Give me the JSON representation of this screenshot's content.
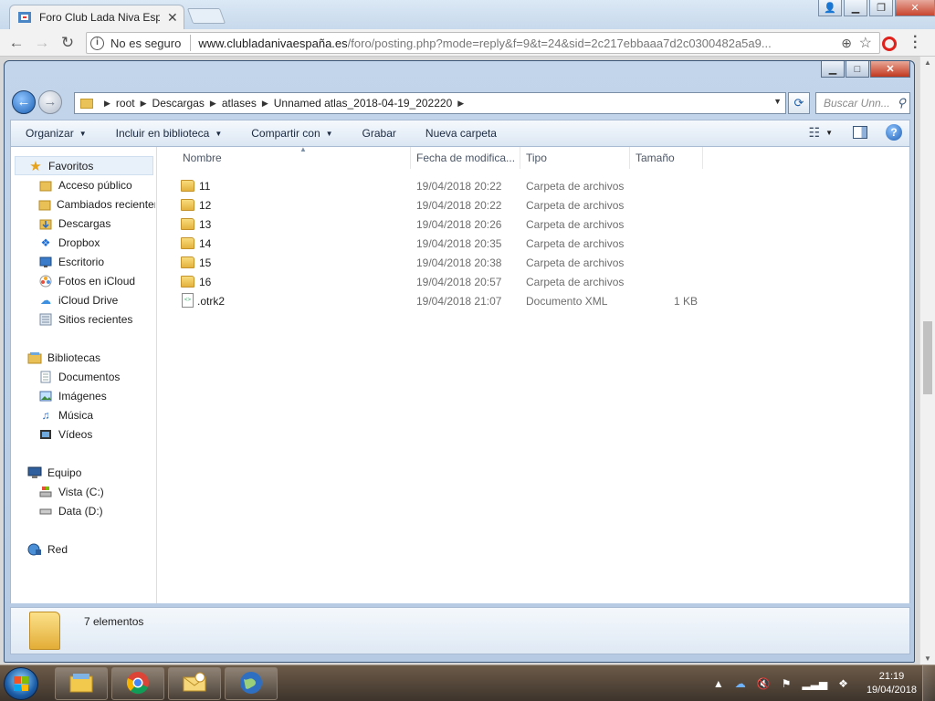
{
  "browser": {
    "tab_title": "Foro Club Lada Niva Espa",
    "insecure_label": "No es seguro",
    "url_host": "www.clubladanivaespaña.es",
    "url_rest": "/foro/posting.php?mode=reply&f=9&t=24&sid=2c217ebbaaa7d2c0300482a5a9..."
  },
  "explorer": {
    "breadcrumb": [
      "root",
      "Descargas",
      "atlases",
      "Unnamed atlas_2018-04-19_202220"
    ],
    "search_placeholder": "Buscar Unn...",
    "toolbar": {
      "organize": "Organizar",
      "include_library": "Incluir en biblioteca",
      "share": "Compartir con",
      "burn": "Grabar",
      "new_folder": "Nueva carpeta"
    },
    "nav": {
      "favorites": {
        "label": "Favoritos",
        "items": [
          "Acceso público",
          "Cambiados recientemente",
          "Descargas",
          "Dropbox",
          "Escritorio",
          "Fotos en iCloud",
          "iCloud Drive",
          "Sitios recientes"
        ]
      },
      "libraries": {
        "label": "Bibliotecas",
        "items": [
          "Documentos",
          "Imágenes",
          "Música",
          "Vídeos"
        ]
      },
      "computer": {
        "label": "Equipo",
        "items": [
          "Vista (C:)",
          "Data (D:)"
        ]
      },
      "network": {
        "label": "Red"
      }
    },
    "columns": [
      "Nombre",
      "Fecha de modifica...",
      "Tipo",
      "Tamaño"
    ],
    "files": [
      {
        "name": "11",
        "date": "19/04/2018 20:22",
        "type": "Carpeta de archivos",
        "size": "",
        "icon": "folder-icon"
      },
      {
        "name": "12",
        "date": "19/04/2018 20:22",
        "type": "Carpeta de archivos",
        "size": "",
        "icon": "folder-icon"
      },
      {
        "name": "13",
        "date": "19/04/2018 20:26",
        "type": "Carpeta de archivos",
        "size": "",
        "icon": "folder-icon"
      },
      {
        "name": "14",
        "date": "19/04/2018 20:35",
        "type": "Carpeta de archivos",
        "size": "",
        "icon": "folder-icon"
      },
      {
        "name": "15",
        "date": "19/04/2018 20:38",
        "type": "Carpeta de archivos",
        "size": "",
        "icon": "folder-icon"
      },
      {
        "name": "16",
        "date": "19/04/2018 20:57",
        "type": "Carpeta de archivos",
        "size": "",
        "icon": "folder-icon"
      },
      {
        "name": ".otrk2",
        "date": "19/04/2018 21:07",
        "type": "Documento XML",
        "size": "1 KB",
        "icon": "xml-file-icon"
      }
    ],
    "status": "7 elementos"
  },
  "taskbar": {
    "time": "21:19",
    "date": "19/04/2018"
  }
}
